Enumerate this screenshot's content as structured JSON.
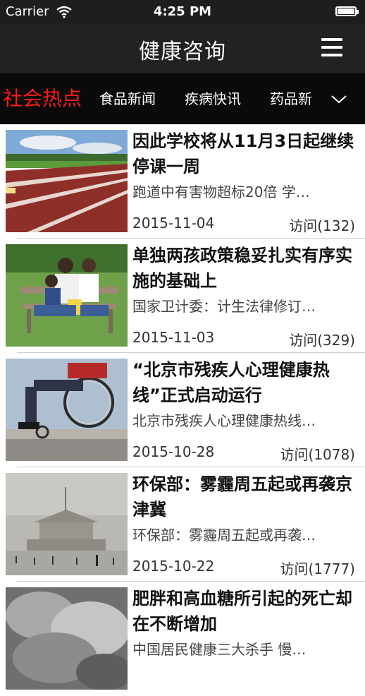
{
  "status_bar": {
    "carrier": "Carrier",
    "time": "4:25 PM",
    "wifi_icon": "wifi-icon",
    "battery_icon": "battery-icon"
  },
  "nav": {
    "title": "健康咨询",
    "menu_icon": "hamburger-menu-icon"
  },
  "tabs": [
    {
      "label": "社会热点",
      "active": true
    },
    {
      "label": "食品新闻",
      "active": false
    },
    {
      "label": "疾病快讯",
      "active": false
    },
    {
      "label": "药品新",
      "active": false
    }
  ],
  "tab_more_icon": "chevron-down-icon",
  "articles": [
    {
      "title": "因此学校将从11月3日起继续停课一周",
      "summary": "跑道中有害物超标20倍 学…",
      "date": "2015-11-04",
      "views": "访问(132)",
      "image": "running-track-photo"
    },
    {
      "title": "单独两孩政策稳妥扎实有序实施的基础上",
      "summary": "国家卫计委：计生法律修订…",
      "date": "2015-11-03",
      "views": "访问(329)",
      "image": "family-on-bench-photo"
    },
    {
      "title": "“北京市残疾人心理健康热线”正式启动运行",
      "summary": "北京市残疾人心理健康热线…",
      "date": "2015-10-28",
      "views": "访问(1078)",
      "image": "wheelchair-photo"
    },
    {
      "title": "环保部：雾霾周五起或再袭京津冀",
      "summary": "环保部：雾霾周五起或再袭…",
      "date": "2015-10-22",
      "views": "访问(1777)",
      "image": "smog-square-photo"
    },
    {
      "title": "肥胖和高血糖所引起的死亡却在不断增加",
      "summary": "中国居民健康三大杀手 慢…",
      "date": "",
      "views": "",
      "image": "smoke-clouds-photo"
    }
  ]
}
